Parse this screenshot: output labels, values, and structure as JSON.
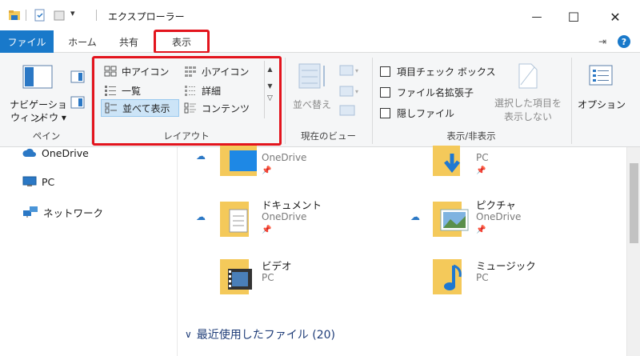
{
  "window": {
    "title": "エクスプローラー",
    "minimize": "—",
    "maximize": "☐",
    "close": "✕",
    "pin_glyph": "⇥",
    "help_glyph": "?"
  },
  "tabs": {
    "file": "ファイル",
    "home": "ホーム",
    "share": "共有",
    "view": "表示"
  },
  "ribbon": {
    "pane_group": {
      "nav_pane_line1": "ナビゲーション",
      "nav_pane_line2": "ウィンドウ ▾",
      "label": "ペイン"
    },
    "layout_group": {
      "medium_icons": "中アイコン",
      "small_icons": "小アイコン",
      "list": "一覧",
      "details": "詳細",
      "tiles": "並べて表示",
      "content": "コンテンツ",
      "label": "レイアウト"
    },
    "current_view_group": {
      "sort": "並べ替え",
      "label": "現在のビュー"
    },
    "show_hide_group": {
      "item_checkboxes": "項目チェック ボックス",
      "file_extensions": "ファイル名拡張子",
      "hidden_files": "隠しファイル",
      "hide_selected_line1": "選択した項目を",
      "hide_selected_line2": "表示しない",
      "label": "表示/非表示"
    },
    "options": "オプション"
  },
  "nav": {
    "onedrive": "OneDrive",
    "pc": "PC",
    "network": "ネットワーク"
  },
  "folders": [
    {
      "name": "",
      "sub": "OneDrive"
    },
    {
      "name": "",
      "sub": "PC"
    },
    {
      "name": "ドキュメント",
      "sub": "OneDrive"
    },
    {
      "name": "ピクチャ",
      "sub": "OneDrive"
    },
    {
      "name": "ビデオ",
      "sub": "PC"
    },
    {
      "name": "ミュージック",
      "sub": "PC"
    }
  ],
  "recent": {
    "chevron": "∨",
    "label": "最近使用したファイル (20)"
  },
  "colors": {
    "accent": "#1979ca",
    "highlight": "#e3141d",
    "folder": "#f4c95a",
    "ribbon_bg": "#f5f6f7"
  }
}
